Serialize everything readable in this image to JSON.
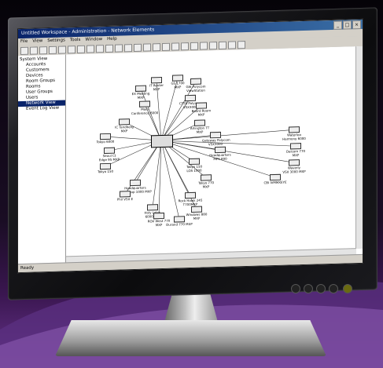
{
  "window": {
    "title": "Untitled Workspace - Administration - Network Elements",
    "controls": [
      "_",
      "□",
      "×"
    ]
  },
  "menu": [
    "File",
    "View",
    "Settings",
    "Tools",
    "Window",
    "Help"
  ],
  "tree": [
    {
      "label": "System View",
      "selected": false
    },
    {
      "label": "Accounts",
      "selected": false
    },
    {
      "label": "Customers",
      "selected": false
    },
    {
      "label": "Devices",
      "selected": false
    },
    {
      "label": "Room Groups",
      "selected": false
    },
    {
      "label": "Rooms",
      "selected": false
    },
    {
      "label": "User Groups",
      "selected": false
    },
    {
      "label": "Users",
      "selected": false
    },
    {
      "label": "Network View",
      "selected": true
    },
    {
      "label": "Event Log View",
      "selected": false
    }
  ],
  "nodes": [
    {
      "label": "Hub",
      "ang": 0
    },
    {
      "label": "IT Router\nMXP",
      "ang": 0
    },
    {
      "label": "GS 1700\nMXP",
      "ang": 0
    },
    {
      "label": "GW Polycom\nViewStation",
      "ang": 0
    },
    {
      "label": "EX Meeting\nMXP",
      "ang": 0
    },
    {
      "label": "Main\nConference 6000",
      "ang": 0
    },
    {
      "label": "CTSS Polycom\nVSX3000",
      "ang": 0
    },
    {
      "label": "Board Room\nMXP",
      "ang": 0
    },
    {
      "label": "Arlington TT\nMXP",
      "ang": 0
    },
    {
      "label": "IC Tandberg\nMXP",
      "ang": 0
    },
    {
      "label": "Gateway Polycom\nVSX3000",
      "ang": 0
    },
    {
      "label": "Tokyo 6000",
      "ang": 0
    },
    {
      "label": "Seoul Ct\nEdge 95 MXP",
      "ang": 0
    },
    {
      "label": "Headquarters\nMPS 800",
      "ang": 0
    },
    {
      "label": "Tokyo 150",
      "ang": 0
    },
    {
      "label": "Tokyo 150\nLOS 1000",
      "ang": 0
    },
    {
      "label": "Headquarters\nDesktop 1000 MXP",
      "ang": 0
    },
    {
      "label": "Tokyo 770\nMXP",
      "ang": 0
    },
    {
      "label": "Phil VSX E",
      "ang": 0
    },
    {
      "label": "Rock Hawk 245\nT700MXP",
      "ang": 0
    },
    {
      "label": "Holy Lotus\n6000MXP",
      "ang": 0
    },
    {
      "label": "Windows 880\nMXP",
      "ang": 0
    },
    {
      "label": "ROV West 770\nMXP",
      "ang": 0
    },
    {
      "label": "Durand 770 MXP",
      "ang": 0
    },
    {
      "label": "Waterloo\nHarmony 6000",
      "ang": 0
    },
    {
      "label": "Dalcom 770\nMXP",
      "ang": 0
    },
    {
      "label": "Waverly\nVSX 3000 MXP",
      "ang": 0
    },
    {
      "label": "CBI IVMMXEYE",
      "ang": 0
    }
  ],
  "status": "Ready"
}
